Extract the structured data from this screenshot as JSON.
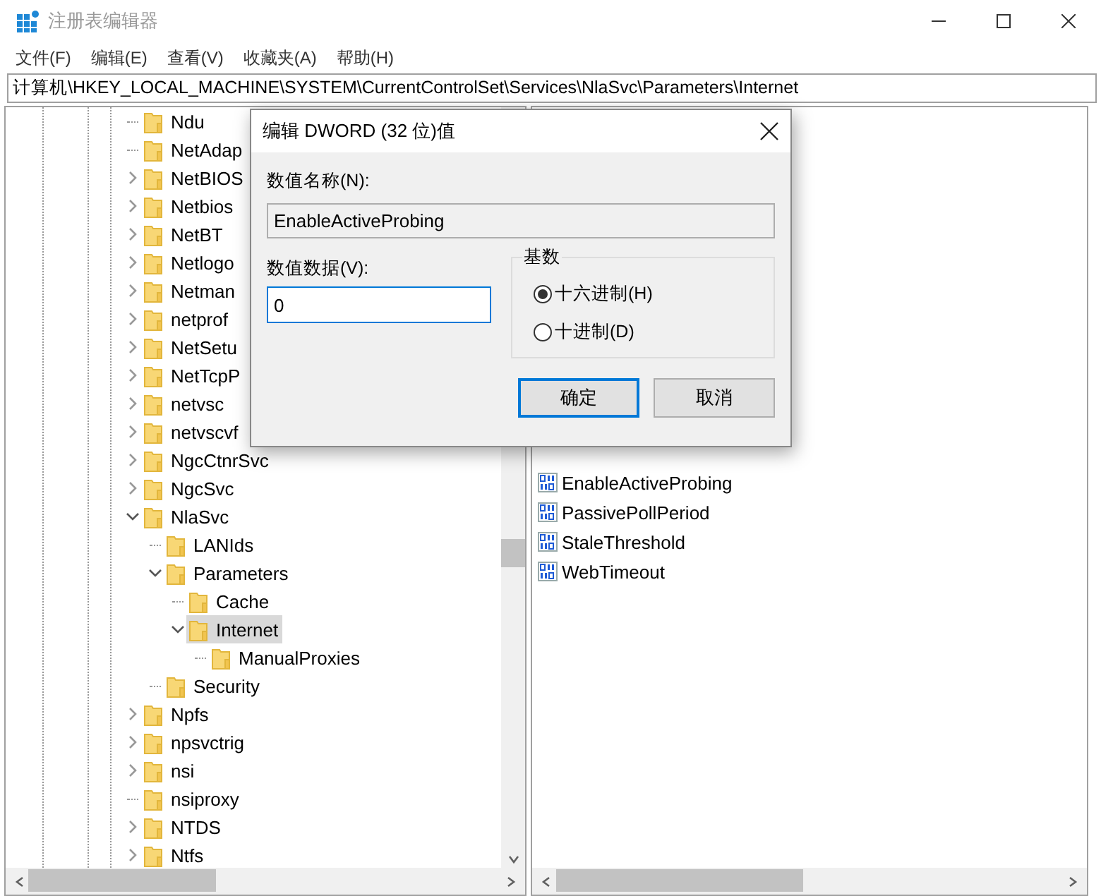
{
  "window": {
    "title": "注册表编辑器"
  },
  "menu": [
    "文件(F)",
    "编辑(E)",
    "查看(V)",
    "收藏夹(A)",
    "帮助(H)"
  ],
  "address": "计算机\\HKEY_LOCAL_MACHINE\\SYSTEM\\CurrentControlSet\\Services\\NlaSvc\\Parameters\\Internet",
  "tree": [
    {
      "name": "Ndu",
      "kind": "leaf",
      "selected": false
    },
    {
      "name": "NetAdap",
      "kind": "leaf",
      "selected": false
    },
    {
      "name": "NetBIOS",
      "kind": "collapsed",
      "selected": false
    },
    {
      "name": "Netbios",
      "kind": "collapsed",
      "selected": false
    },
    {
      "name": "NetBT",
      "kind": "collapsed",
      "selected": false
    },
    {
      "name": "Netlogo",
      "kind": "collapsed",
      "selected": false
    },
    {
      "name": "Netman",
      "kind": "collapsed",
      "selected": false
    },
    {
      "name": "netprof",
      "kind": "collapsed",
      "selected": false
    },
    {
      "name": "NetSetu",
      "kind": "collapsed",
      "selected": false
    },
    {
      "name": "NetTcpP",
      "kind": "collapsed",
      "selected": false
    },
    {
      "name": "netvsc",
      "kind": "collapsed",
      "selected": false
    },
    {
      "name": "netvscvf",
      "kind": "collapsed",
      "selected": false
    },
    {
      "name": "NgcCtnrSvc",
      "kind": "collapsed",
      "selected": false
    },
    {
      "name": "NgcSvc",
      "kind": "collapsed",
      "selected": false
    },
    {
      "name": "NlaSvc",
      "kind": "expanded",
      "selected": false,
      "children": [
        {
          "name": "LANIds",
          "kind": "leaf",
          "selected": false
        },
        {
          "name": "Parameters",
          "kind": "expanded",
          "selected": false,
          "children": [
            {
              "name": "Cache",
              "kind": "leaf",
              "selected": false
            },
            {
              "name": "Internet",
              "kind": "expanded",
              "selected": true,
              "children": [
                {
                  "name": "ManualProxies",
                  "kind": "leaf",
                  "selected": false
                }
              ]
            }
          ]
        },
        {
          "name": "Security",
          "kind": "leaf",
          "selected": false
        }
      ]
    },
    {
      "name": "Npfs",
      "kind": "collapsed",
      "selected": false
    },
    {
      "name": "npsvctrig",
      "kind": "collapsed",
      "selected": false
    },
    {
      "name": "nsi",
      "kind": "collapsed",
      "selected": false
    },
    {
      "name": "nsiproxy",
      "kind": "leaf",
      "selected": false
    },
    {
      "name": "NTDS",
      "kind": "collapsed",
      "selected": false
    },
    {
      "name": "Ntfs",
      "kind": "collapsed",
      "selected": false
    }
  ],
  "values": [
    {
      "name": "EnableActiveProbing"
    },
    {
      "name": "PassivePollPeriod"
    },
    {
      "name": "StaleThreshold"
    },
    {
      "name": "WebTimeout"
    }
  ],
  "dialog": {
    "title": "编辑 DWORD (32 位)值",
    "name_label": "数值名称(N):",
    "name_value": "EnableActiveProbing",
    "data_label": "数值数据(V):",
    "data_value": "0",
    "base_label": "基数",
    "radios": [
      {
        "label": "十六进制(H)",
        "selected": true
      },
      {
        "label": "十进制(D)",
        "selected": false
      }
    ],
    "buttons": [
      {
        "label": "确定",
        "default": true
      },
      {
        "label": "取消",
        "default": false
      }
    ]
  }
}
